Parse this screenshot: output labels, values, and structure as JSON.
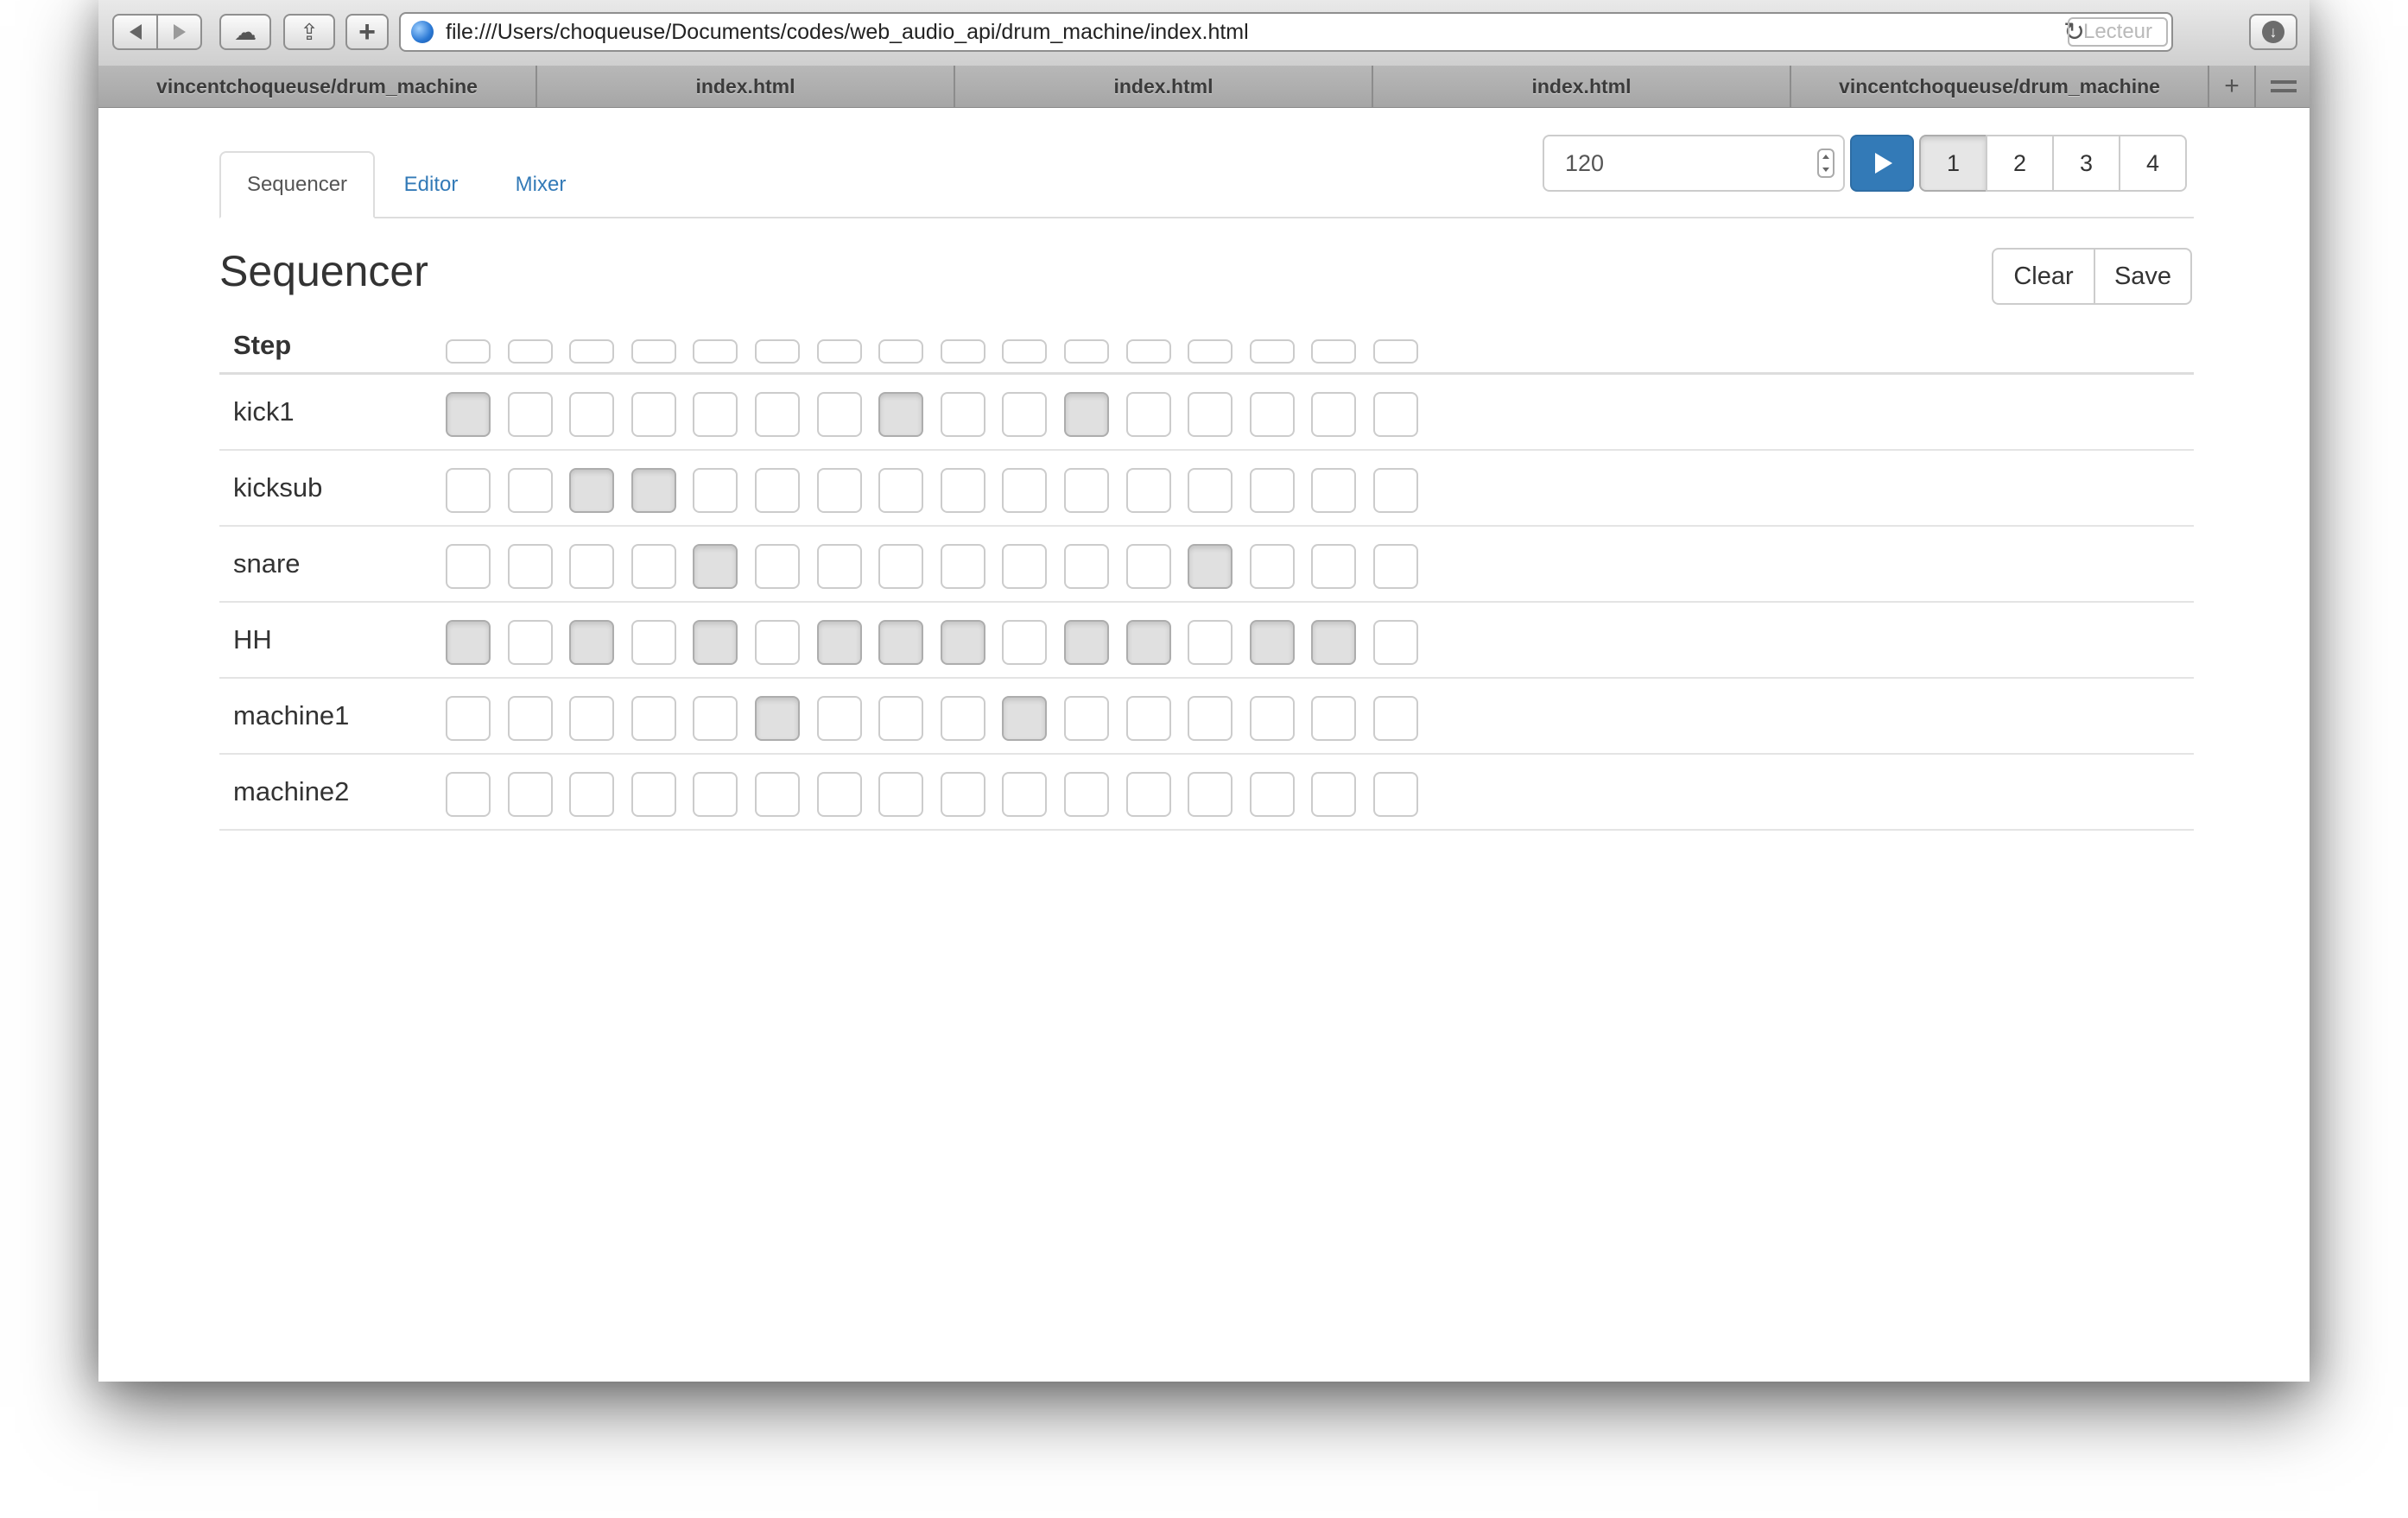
{
  "browser": {
    "url": "file:///Users/choqueuse/Documents/codes/web_audio_api/drum_machine/index.html",
    "reader_label": "Lecteur",
    "tabs": [
      {
        "label": "vincentchoqueuse/drum_machine"
      },
      {
        "label": "index.html"
      },
      {
        "label": "index.html"
      },
      {
        "label": "index.html"
      },
      {
        "label": "vincentchoqueuse/drum_machine"
      }
    ],
    "new_tab_label": "+"
  },
  "app": {
    "nav_tabs": [
      {
        "label": "Sequencer",
        "active": true
      },
      {
        "label": "Editor",
        "active": false
      },
      {
        "label": "Mixer",
        "active": false
      }
    ],
    "tempo": "120",
    "patterns": [
      {
        "label": "1",
        "active": true
      },
      {
        "label": "2",
        "active": false
      },
      {
        "label": "3",
        "active": false
      },
      {
        "label": "4",
        "active": false
      }
    ],
    "section_title": "Sequencer",
    "clear_label": "Clear",
    "save_label": "Save"
  },
  "sequencer": {
    "step_label": "Step",
    "steps": 16,
    "tracks": [
      {
        "name": "kick1",
        "pattern": [
          1,
          0,
          0,
          0,
          0,
          0,
          0,
          1,
          0,
          0,
          1,
          0,
          0,
          0,
          0,
          0
        ]
      },
      {
        "name": "kicksub",
        "pattern": [
          0,
          0,
          1,
          1,
          0,
          0,
          0,
          0,
          0,
          0,
          0,
          0,
          0,
          0,
          0,
          0
        ]
      },
      {
        "name": "snare",
        "pattern": [
          0,
          0,
          0,
          0,
          1,
          0,
          0,
          0,
          0,
          0,
          0,
          0,
          1,
          0,
          0,
          0
        ]
      },
      {
        "name": "HH",
        "pattern": [
          1,
          0,
          1,
          0,
          1,
          0,
          1,
          1,
          1,
          0,
          1,
          1,
          0,
          1,
          1,
          0
        ]
      },
      {
        "name": "machine1",
        "pattern": [
          0,
          0,
          0,
          0,
          0,
          1,
          0,
          0,
          0,
          1,
          0,
          0,
          0,
          0,
          0,
          0
        ]
      },
      {
        "name": "machine2",
        "pattern": [
          0,
          0,
          0,
          0,
          0,
          0,
          0,
          0,
          0,
          0,
          0,
          0,
          0,
          0,
          0,
          0
        ]
      }
    ]
  }
}
